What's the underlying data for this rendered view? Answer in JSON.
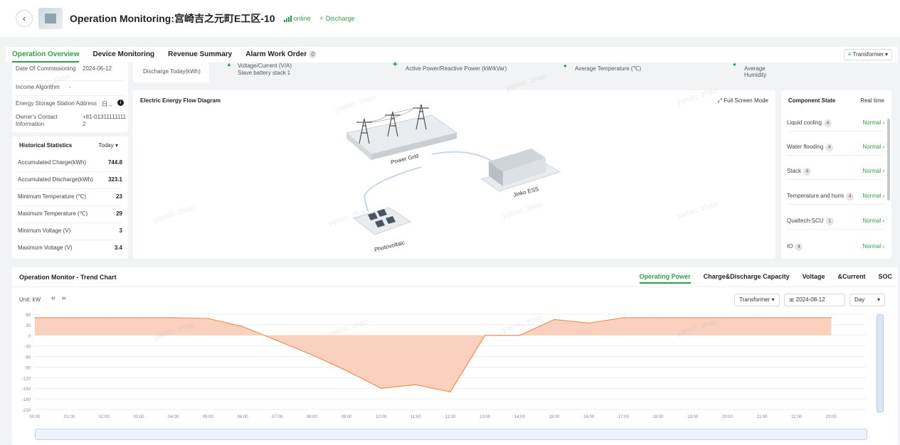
{
  "header": {
    "title": "Operation Monitoring:宫崎吉之元町E工区-10",
    "online": "online",
    "discharge": "Discharge"
  },
  "tabs": [
    {
      "label": "Operation Overview"
    },
    {
      "label": "Device Monitoring"
    },
    {
      "label": "Revenue Summary"
    },
    {
      "label": "Alarm Work Order",
      "badge": "0"
    }
  ],
  "transformer_select": "Transformer",
  "info": {
    "commissioning_label": "Date Of Commissioning",
    "commissioning_value": "2024-06-12",
    "income_label": "Income Algorithm",
    "income_value": "-",
    "address_label": "Energy Storage Station Address",
    "address_value": "日...",
    "contact_label": "Owner's Contact Information",
    "contact_value": "+81-013111111112"
  },
  "metrics": {
    "discharge_today": "Discharge Today(kWh)",
    "voltage_current": "Voltage/Current (V/A)",
    "slave": "Slave battery stack 1",
    "active_power": "Active Power/Reactive Power (kW/kVar)",
    "avg_temp": "Average Temperature (℃)",
    "avg_humidity": "Average Humidity"
  },
  "historical": {
    "title": "Historical Statistics",
    "period": "Today",
    "rows": [
      {
        "label": "Accumulated Charge(kWh)",
        "value": "744.8"
      },
      {
        "label": "Accumulated Discharge(kWh)",
        "value": "323.1"
      },
      {
        "label": "Minimum Temperature (℃)",
        "value": "23"
      },
      {
        "label": "Maximum Temperature (℃)",
        "value": "29"
      },
      {
        "label": "Minimum Voltage (V)",
        "value": "3"
      },
      {
        "label": "Maximum Voltage (V)",
        "value": "3.4"
      }
    ]
  },
  "flow": {
    "title": "Electric Energy Flow Diagram",
    "fullscreen": "Full Screen Mode",
    "grid": "Power Grid",
    "ess": "Jinko ESS",
    "pv": "Photovoltaic"
  },
  "components": {
    "title": "Component State",
    "mode": "Real time",
    "rows": [
      {
        "name": "Liquid cooling",
        "count": "4",
        "state": "Normal"
      },
      {
        "name": "Water flooding",
        "count": "4",
        "state": "Normal"
      },
      {
        "name": "Stack",
        "count": "4",
        "state": "Normal"
      },
      {
        "name": "Temperature and humi",
        "count": "4",
        "state": "Normal"
      },
      {
        "name": "Qualtech-SCU",
        "count": "1",
        "state": "Normal"
      },
      {
        "name": "IO",
        "count": "4",
        "state": "Normal"
      }
    ]
  },
  "trend": {
    "title": "Operation Monitor - Trend Chart",
    "tabs": [
      "Operating Power",
      "Charge&Discharge Capacity",
      "Voltage",
      "&Current",
      "SOC"
    ],
    "unit": "Unit:  kW",
    "transformer": "Transformer",
    "date": "2024-08-12",
    "period": "Day"
  },
  "watermark": "yamin. zhao",
  "colors": {
    "accent": "#2e9e4a",
    "area_fill": "#f9c9b3",
    "area_line": "#ef8f5f"
  },
  "chart_data": {
    "type": "area",
    "x": [
      "00:00",
      "01:00",
      "02:00",
      "03:00",
      "04:00",
      "05:00",
      "06:00",
      "07:00",
      "08:00",
      "09:00",
      "10:00",
      "11:00",
      "12:00",
      "13:00",
      "14:00",
      "15:00",
      "16:00",
      "17:00",
      "18:00",
      "19:00",
      "20:00",
      "21:00",
      "22:00",
      "23:00"
    ],
    "xlabels": [
      "00:00",
      "01:00",
      "02:00",
      "03:00",
      "04:00",
      "05:00",
      "06:00",
      "07:00",
      "08:00",
      "09:00",
      "10:00",
      "11:00",
      "12:00",
      "13:00",
      "14:00",
      "15:00",
      "16:00",
      "17:00",
      "18:00",
      "19:00",
      "20:00",
      "21:00",
      "22:00",
      "23:00"
    ],
    "yticks": [
      60,
      30,
      0,
      -30,
      -60,
      -90,
      -120,
      -150,
      -180,
      -210
    ],
    "ylim": [
      -210,
      60
    ],
    "series": [
      {
        "values": [
          50,
          50,
          50,
          50,
          50,
          48,
          25,
          -15,
          -55,
          -100,
          -150,
          -140,
          -160,
          0,
          0,
          45,
          35,
          50,
          50,
          50,
          50,
          50,
          50,
          50
        ]
      }
    ]
  }
}
